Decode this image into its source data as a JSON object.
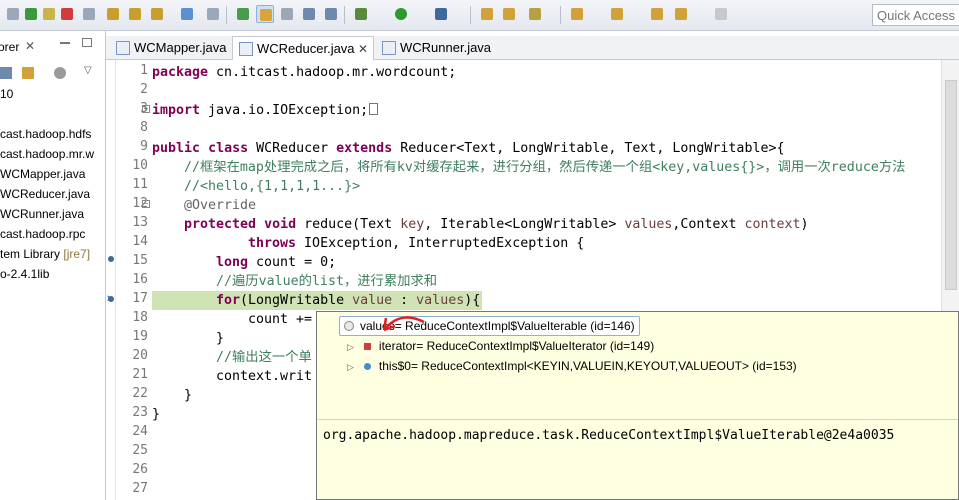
{
  "toolbar": {
    "quick_access_placeholder": "Quick Access"
  },
  "explorer": {
    "tab_label": "orer",
    "tab_close": "✕",
    "items": [
      {
        "label": "10"
      },
      {
        "label": "cast.hadoop.hdfs"
      },
      {
        "label": "cast.hadoop.mr.w"
      },
      {
        "label": "WCMapper.java"
      },
      {
        "label": "WCReducer.java"
      },
      {
        "label": "WCRunner.java"
      },
      {
        "label": "cast.hadoop.rpc"
      },
      {
        "label": "tem Library",
        "decoration": "[jre7]"
      },
      {
        "label": "o-2.4.1lib"
      }
    ]
  },
  "editor_tabs": [
    {
      "label": "WCMapper.java",
      "active": false
    },
    {
      "label": "WCReducer.java",
      "active": true,
      "close": "✕"
    },
    {
      "label": "WCRunner.java",
      "active": false
    }
  ],
  "editor": {
    "line_numbers": [
      "1",
      "2",
      "3",
      "8",
      "9",
      "10",
      "11",
      "12",
      "13",
      "14",
      "15",
      "16",
      "17",
      "18",
      "19",
      "20",
      "21",
      "22",
      "23",
      "24",
      "25",
      "26",
      "27"
    ],
    "tokens": {
      "package": "package",
      "package_name": " cn.itcast.hadoop.mr.wordcount;",
      "import": "import",
      "import_name": " java.io.IOException;",
      "public": "public",
      "class": "class",
      "class_name": " WCReducer ",
      "extends": "extends",
      "extends_rest": " Reducer<Text, LongWritable, Text, LongWritable>{",
      "comment1": "//框架在map处理完成之后，将所有kv对缓存起来，进行分组，然后传递一个组<key,values{}>，调用一次reduce方法",
      "comment2": "//<hello,{1,1,1,1...}>",
      "override": "@Override",
      "protected": "protected",
      "void": "void",
      "reduce_sig_a": " reduce(Text ",
      "reduce_key": "key",
      "reduce_sig_b": ", Iterable<LongWritable> ",
      "reduce_values": "values",
      "reduce_sig_c": ",Context ",
      "reduce_context": "context",
      "reduce_sig_d": ")",
      "throws": "throws",
      "throws_rest": " IOException, InterruptedException {",
      "long": "long",
      "count_decl": " count = 0;",
      "comment3": "//遍历value的list，进行累加求和",
      "for": "for",
      "for_a": "(LongWritable ",
      "for_value": "value",
      "for_b": " : ",
      "for_values": "values",
      "for_c": "){",
      "count_add": "count +=",
      "close_brace": "}",
      "comment4": "//输出这一个单",
      "context_write": "context.writ",
      "method_close": "}",
      "class_close": "}"
    }
  },
  "popup": {
    "root": "values= ReduceContextImpl$ValueIterable  (id=146)",
    "children": [
      {
        "label": "iterator= ReduceContextImpl$ValueIterator  (id=149)"
      },
      {
        "label": "this$0= ReduceContextImpl<KEYIN,VALUEIN,KEYOUT,VALUEOUT>  (id=153)"
      }
    ],
    "value": "org.apache.hadoop.mapreduce.task.ReduceContextImpl$ValueIterable@2e4a0035"
  }
}
